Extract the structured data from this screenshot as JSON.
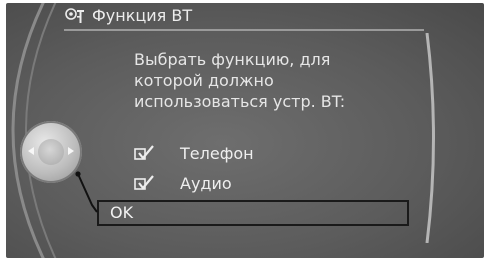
{
  "window": {
    "title": "Функция BT",
    "title_icon": "bluetooth-settings-icon"
  },
  "prompt": {
    "line1": "Выбрать функцию, для",
    "line2": "которой должно",
    "line3": "использоваться устр. BT:"
  },
  "options": [
    {
      "label": "Телефон",
      "checked": true,
      "icon": "checkbox-checked-icon"
    },
    {
      "label": "Аудио",
      "checked": true,
      "icon": "checkbox-checked-icon"
    }
  ],
  "confirm": {
    "label": "OK"
  },
  "controller": {
    "icon": "idrive-controller-icon",
    "left_arrow": "arrow-left-icon",
    "right_arrow": "arrow-right-icon"
  },
  "colors": {
    "background": "#5c5c5c",
    "text": "#e6e6e6",
    "highlight_border": "#1a1a1a"
  }
}
